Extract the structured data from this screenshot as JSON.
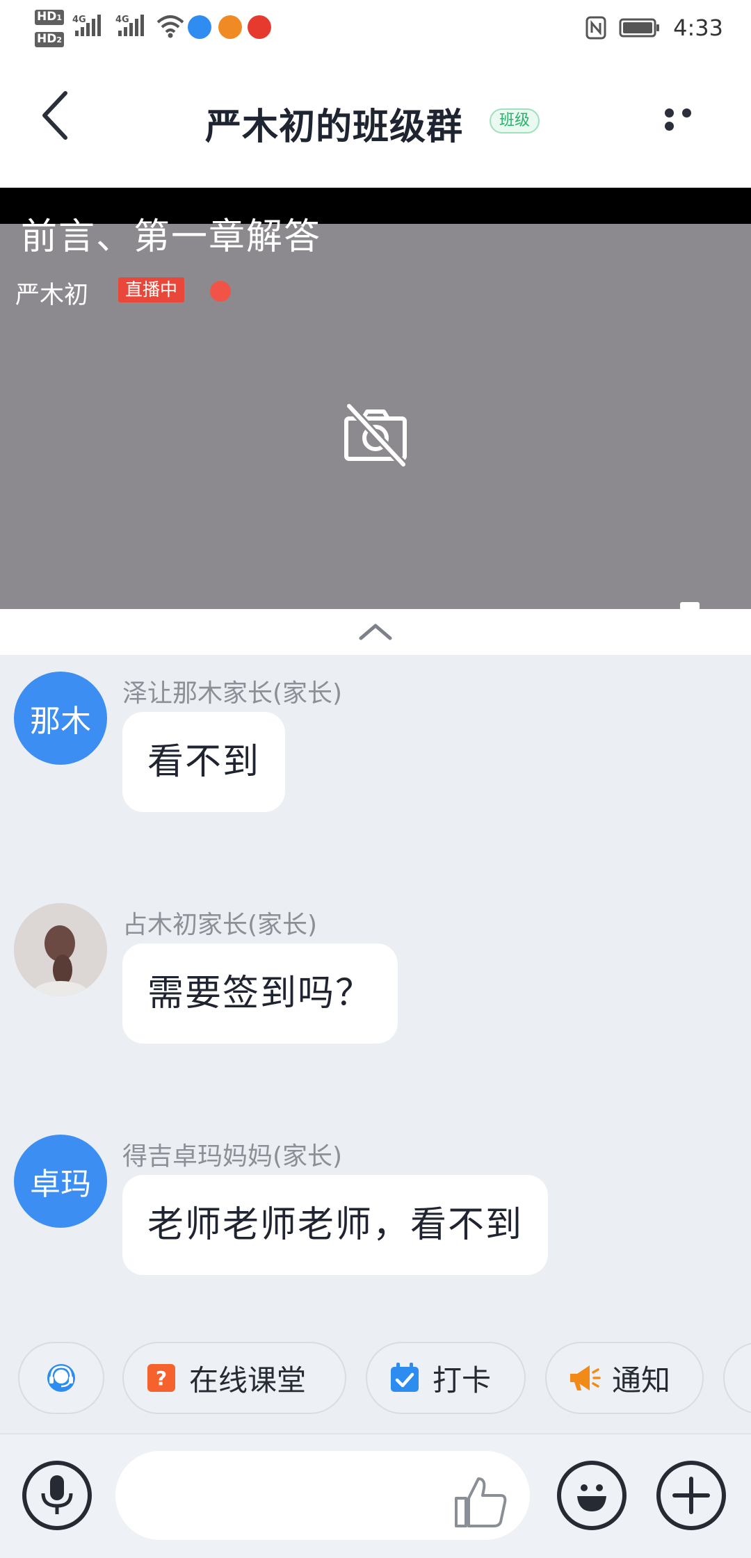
{
  "status_bar": {
    "time": "4:33",
    "network_1": "4G",
    "network_2": "4G",
    "hd_1": "HD",
    "hd_2": "HD"
  },
  "header": {
    "title": "严木初的班级群",
    "badge": "班级"
  },
  "video": {
    "title": "前言、第一章解答",
    "host": "严木初",
    "live_label": "直播中",
    "colors": {
      "background": "#8c8a8e",
      "live": "#e8473a"
    }
  },
  "messages": [
    {
      "sender": "泽让那木家长(家长)",
      "avatar_text": "那木",
      "text": "看不到"
    },
    {
      "sender": "占木初家长(家长)",
      "avatar_text": "",
      "text": "需要签到吗？"
    },
    {
      "sender": "得吉卓玛妈妈(家长)",
      "avatar_text": "卓玛",
      "text": "老师老师老师，看不到"
    }
  ],
  "tools": [
    {
      "label": "",
      "icon": "headset-icon"
    },
    {
      "label": "在线课堂",
      "icon": "online-class-icon"
    },
    {
      "label": "打卡",
      "icon": "check-in-icon"
    },
    {
      "label": "通知",
      "icon": "megaphone-icon"
    }
  ],
  "input": {
    "placeholder": ""
  },
  "colors": {
    "accent_blue": "#3d8ef2",
    "chat_bg": "#ebeff4",
    "badge_green": "#27b36a"
  }
}
